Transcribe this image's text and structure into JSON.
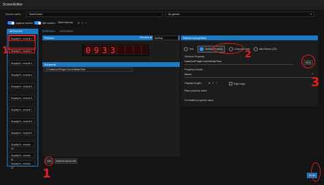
{
  "window": {
    "title": "ScreenEditor"
  },
  "top": {
    "screen_name_label": "Screen name",
    "screen_name_value": "TimeScreen",
    "games_select": "All games",
    "ingame_label": "Ingame screen",
    "idle_label": "Idle screen",
    "blink_label": "Blink interval",
    "blink_value": "0",
    "ingame_on": true,
    "idle_on": true
  },
  "modules": {
    "header": "MODULES",
    "items": [
      "DisplayHi - module 1",
      "DisplayHi - module 2",
      "DisplayHi - module 3",
      "DisplayHi - module 4",
      "DisplayHi - module 5",
      "DisplayHi - module 6",
      "DisplayHi - module 7",
      "DisplayHi - module 8",
      "DisplayHi - module 9",
      "DisplayHi - module 10",
      "DisplayHi - module 11",
      "DisplayHi - module 12"
    ]
  },
  "tabs": {
    "definition": "Definition",
    "animation": "Animation"
  },
  "preview": {
    "header": "Preview",
    "preview_as_label": "Preview as",
    "preview_as_value": "SimDay",
    "digits": [
      "0",
      "9",
      "3",
      "3",
      "",
      "",
      "",
      ""
    ]
  },
  "elements": {
    "header": "Elements",
    "items": [
      "DataCorePlugin.CurrentDateTime"
    ],
    "add_label": "ADD",
    "remove_label": "REMOVE SELECTED"
  },
  "properties": {
    "header": "Element properties",
    "types": [
      "Text",
      "SimHub Property",
      "Computed text",
      "New Return (CE)"
    ],
    "simhub_property_label": "SimHub Property",
    "simhub_property_value": "DataCorePlugin.CurrentDateTime",
    "pick_label": "PICK",
    "format_label": "Property format :",
    "format_value": "Munor",
    "display_length_label": "Display length :",
    "display_length_value": "4",
    "right_align_label": "Right align",
    "raw_value_label": "Raw property value",
    "formatted_value_label": "Formatted property value"
  },
  "footer": {
    "save_label": "Save"
  },
  "annotations": {
    "one": "1",
    "two": "2",
    "three": "3"
  },
  "colors": {
    "accent": "#1a7bc4",
    "annotation": "#e01e1e",
    "segment": "#ff3b3b"
  }
}
